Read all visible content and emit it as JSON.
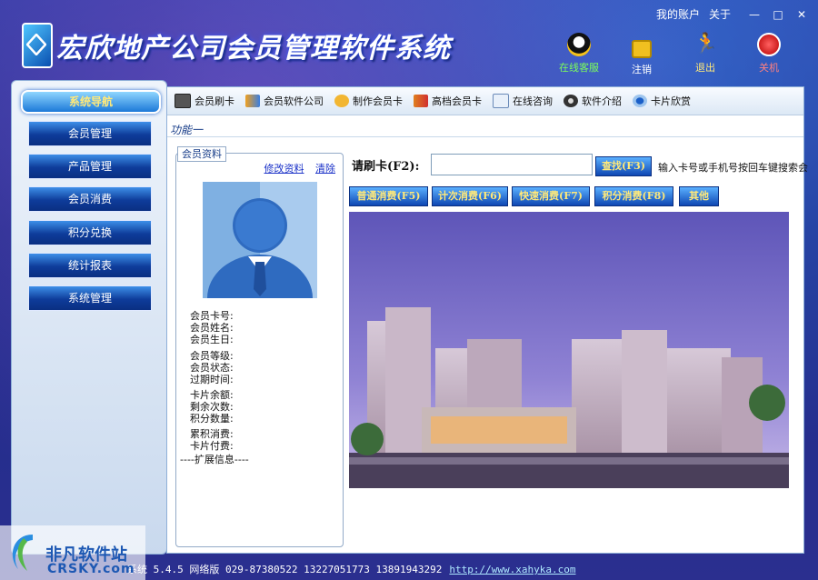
{
  "app": {
    "title": "宏欣地产公司会员管理软件系统"
  },
  "topbar": {
    "account": "我的账户",
    "about": "关于",
    "minimize": "—",
    "restore": "□",
    "close": "✕"
  },
  "header_buttons": [
    {
      "label": "在线客服",
      "color": "#7cff5a",
      "icon": "qq-penguin-icon"
    },
    {
      "label": "注销",
      "color": "#ffffff",
      "icon": "lock-icon"
    },
    {
      "label": "退出",
      "color": "#ffe97a",
      "icon": "running-man-icon"
    },
    {
      "label": "关机",
      "color": "#ff6a6a",
      "icon": "power-icon"
    }
  ],
  "sidebar": {
    "header": "系统导航",
    "items": [
      "会员管理",
      "产品管理",
      "会员消费",
      "积分兑换",
      "统计报表",
      "系统管理"
    ]
  },
  "toolbar": {
    "items": [
      {
        "label": "会员刷卡",
        "icon": "card-swipe-icon"
      },
      {
        "label": "会员软件公司",
        "icon": "company-icon"
      },
      {
        "label": "制作会员卡",
        "icon": "make-card-icon"
      },
      {
        "label": "高档会员卡",
        "icon": "premium-card-icon"
      },
      {
        "label": "在线咨询",
        "icon": "mail-icon"
      },
      {
        "label": "软件介绍",
        "icon": "disc-icon"
      },
      {
        "label": "卡片欣赏",
        "icon": "eye-icon"
      }
    ]
  },
  "main": {
    "function_label": "功能一",
    "member": {
      "tab": "会员资料",
      "edit_link": "修改资料",
      "clear_link": "清除",
      "fields_a": [
        "会员卡号:",
        "会员姓名:",
        "会员生日:"
      ],
      "fields_b": [
        "会员等级:",
        "会员状态:",
        "过期时间:"
      ],
      "fields_c": [
        "卡片余额:",
        "剩余次数:",
        "积分数量:"
      ],
      "fields_d": [
        "累积消费:",
        "卡片付费:"
      ],
      "extended": "----扩展信息----"
    },
    "search": {
      "label": "请刷卡(F2):",
      "value": "",
      "button": "查找(F3)",
      "hint": "输入卡号或手机号按回车键搜索会"
    },
    "actions": [
      "普通消费(F5)",
      "计次消费(F6)",
      "快速消费(F7)",
      "积分消费(F8)",
      "其他"
    ]
  },
  "footer": {
    "text": "系统 5.4.5 网络版 029-87380522 13227051773 13891943292",
    "link": "http://www.xahyka.com"
  },
  "watermark": {
    "line1": "非凡软件站",
    "line2": "CRSKY.com"
  }
}
